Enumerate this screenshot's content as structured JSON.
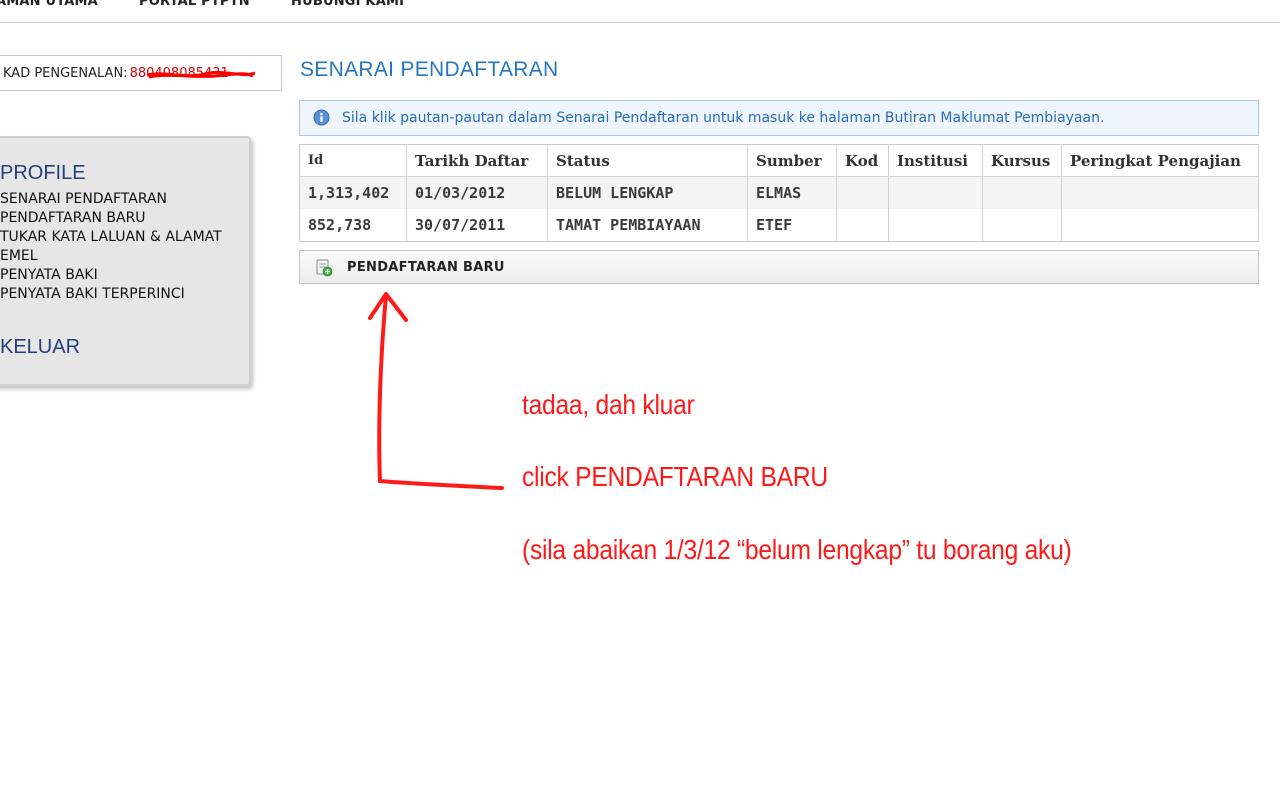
{
  "nav": {
    "items": [
      "AMAN UTAMA",
      "PORTAL PTPTN",
      "HUBUNGI KAMI"
    ]
  },
  "ic": {
    "label": "KAD PENGENALAN:",
    "value": "880408085431"
  },
  "side_menu": {
    "profile": "PROFILE",
    "links": [
      "SENARAI PENDAFTARAN",
      "PENDAFTARAN BARU",
      "TUKAR KATA LALUAN & ALAMAT",
      "EMEL",
      "PENYATA BAKI",
      "PENYATA BAKI TERPERINCI"
    ],
    "logout": "KELUAR"
  },
  "main": {
    "title": "SENARAI PENDAFTARAN",
    "info_text": "Sila klik pautan-pautan dalam Senarai Pendaftaran untuk masuk ke halaman Butiran Maklumat Pembiayaan.",
    "table": {
      "headers": [
        "Id",
        "Tarikh Daftar",
        "Status",
        "Sumber",
        "Kod",
        "Institusi",
        "Kursus",
        "Peringkat Pengajian"
      ],
      "rows": [
        [
          "1,313,402",
          "01/03/2012",
          "BELUM LENGKAP",
          "ELMAS",
          "",
          "",
          "",
          ""
        ],
        [
          "852,738",
          "30/07/2011",
          "TAMAT PEMBIAYAAN",
          "ETEF",
          "",
          "",
          "",
          ""
        ]
      ]
    },
    "new_registration_button": "PENDAFTARAN BARU"
  },
  "annotations": {
    "lines": [
      "tadaa, dah kluar",
      "click PENDAFTARAN BARU",
      "(sila abaikan 1/3/12 “belum lengkap” tu borang aku)"
    ],
    "color": "#ff1a1a"
  },
  "colors": {
    "title_blue": "#2777bf",
    "menu_blue": "#243f7d",
    "info_bg": "#eef5fc"
  },
  "icons": {
    "info": "info-icon",
    "new_registration": "add-document-icon",
    "redaction": "redaction-scribble",
    "arrow": "red-arrow-annotation"
  }
}
